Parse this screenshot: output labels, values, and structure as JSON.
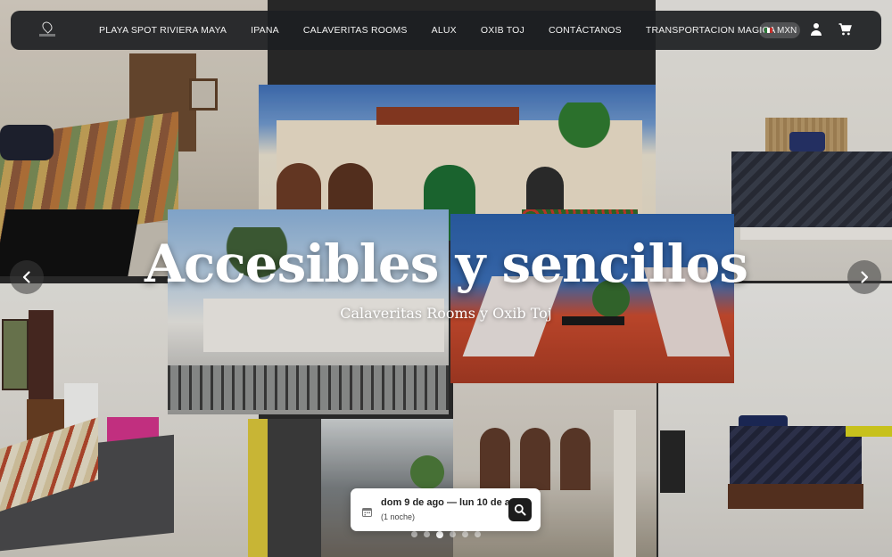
{
  "nav": {
    "items": [
      "PLAYA SPOT RIVIERA MAYA",
      "IPANA",
      "CALAVERITAS ROOMS",
      "ALUX",
      "OXIB TOJ",
      "CONTÁCTANOS",
      "TRANSPORTACION MAGICA"
    ],
    "currency": "MXN"
  },
  "hero": {
    "title": "Accesibles y sencillos",
    "subtitle": "Calaveritas Rooms y Oxib Toj"
  },
  "booking": {
    "dates": "dom 9 de ago — lun 10 de ago",
    "nights": "(1 noche)"
  },
  "carousel": {
    "slide_count": 6,
    "active_index": 2
  },
  "icons": {
    "logo": "location-pin-logo",
    "user": "user-icon",
    "cart": "cart-icon",
    "prev": "chevron-left-icon",
    "next": "chevron-right-icon",
    "calendar": "calendar-icon",
    "search": "search-icon"
  }
}
